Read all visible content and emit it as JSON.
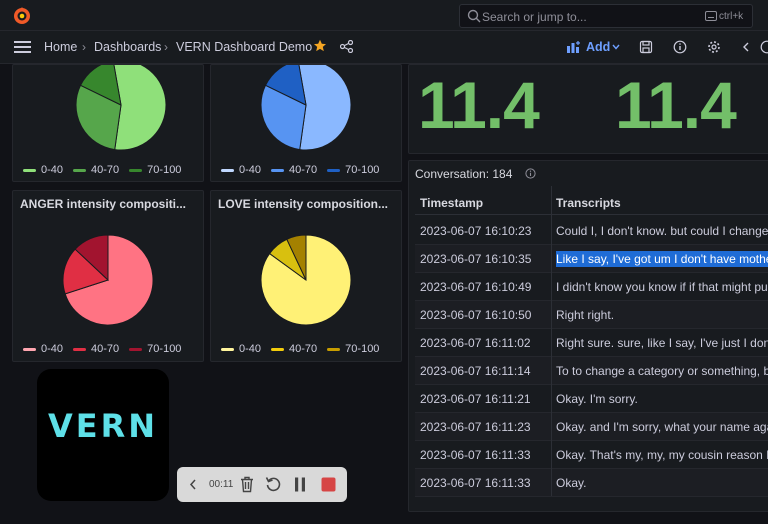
{
  "topbar": {
    "search_placeholder": "Search or jump to...",
    "shortcut": "ctrl+k"
  },
  "breadcrumbs": [
    "Home",
    "Dashboards",
    "VERN Dashboard Demo"
  ],
  "navbar": {
    "add_label": "Add"
  },
  "panels": {
    "top_left": {
      "legend": [
        "0-40",
        "40-70",
        "70-100"
      ],
      "slices": [
        0.55,
        0.3,
        0.15
      ],
      "colors": [
        "#8fe07a",
        "#56a64b",
        "#37872d"
      ]
    },
    "top_mid": {
      "legend": [
        "0-40",
        "40-70",
        "70-100"
      ],
      "slices": [
        0.55,
        0.3,
        0.15
      ],
      "colors": [
        "#8ab8ff",
        "#5794f2",
        "#1f60c4"
      ]
    },
    "anger": {
      "title": "ANGER intensity compositi...",
      "legend": [
        "0-40",
        "40-70",
        "70-100"
      ],
      "slices": [
        0.7,
        0.17,
        0.13
      ],
      "colors": [
        "#ff7383",
        "#e02f44",
        "#a2142f"
      ]
    },
    "love": {
      "title": "LOVE intensity composition...",
      "legend": [
        "0-40",
        "40-70",
        "70-100"
      ],
      "slices": [
        0.85,
        0.08,
        0.07
      ],
      "colors": [
        "#fff176",
        "#d8c00f",
        "#a48100"
      ]
    }
  },
  "stats": [
    "11.4",
    "11.4"
  ],
  "conversation": {
    "title": "Conversation: 184",
    "headers": [
      "Timestamp",
      "Transcripts"
    ],
    "rows": [
      {
        "ts": "2023-06-07 16:10:23",
        "text": "Could I, I don't know. but could I change"
      },
      {
        "ts": "2023-06-07 16:10:35",
        "text": "Like I say, I've got um I don't have mothe",
        "selected": true
      },
      {
        "ts": "2023-06-07 16:10:49",
        "text": "I didn't know you know if if that might pu"
      },
      {
        "ts": "2023-06-07 16:10:50",
        "text": "Right right."
      },
      {
        "ts": "2023-06-07 16:11:02",
        "text": "Right sure. sure, like I say, I've just I don't"
      },
      {
        "ts": "2023-06-07 16:11:14",
        "text": "To to change a category or something, b"
      },
      {
        "ts": "2023-06-07 16:11:21",
        "text": "Okay. I'm sorry."
      },
      {
        "ts": "2023-06-07 16:11:23",
        "text": "Okay. and I'm sorry, what your name aga"
      },
      {
        "ts": "2023-06-07 16:11:33",
        "text": "Okay. That's my, my, my cousin reason I"
      },
      {
        "ts": "2023-06-07 16:11:33",
        "text": "Okay."
      }
    ]
  },
  "vern_logo": "VERN",
  "recorder": {
    "time": "00:11"
  }
}
